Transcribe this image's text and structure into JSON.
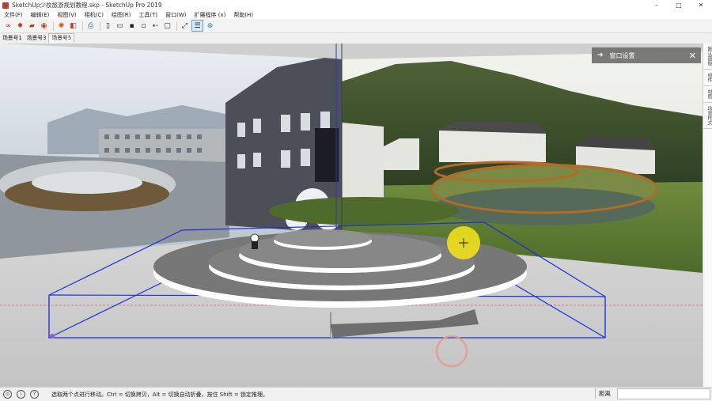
{
  "window": {
    "title": "SketchUp少校旅游规划教程.skp - SketchUp Pro 2019",
    "minimize": "–",
    "maximize": "□",
    "close": "✕"
  },
  "menu": [
    "文件(F)",
    "编辑(E)",
    "视图(V)",
    "相机(C)",
    "绘图(R)",
    "工具(T)",
    "窗口(W)",
    "扩展程序 (x)",
    "帮助(H)"
  ],
  "scene_tabs": [
    "场景号1",
    "场景号3",
    "场景号5"
  ],
  "active_scene": 2,
  "tray": {
    "title": "窗口设置",
    "pin_icon": "➔",
    "close_icon": "✕"
  },
  "right_dock": [
    "默认面板",
    "组件",
    "材质",
    "场景样式"
  ],
  "status": {
    "hint": "选取两个点进行移动。Ctrl = 切换拷贝，Alt = 切换自动折叠，按住 Shift = 锁定推理。",
    "measure_label": "距离",
    "measure_value": ""
  },
  "colors": {
    "selection": "#1f2fd6",
    "cursor": "#f5e21a",
    "axis_red": "#d23a3a"
  }
}
